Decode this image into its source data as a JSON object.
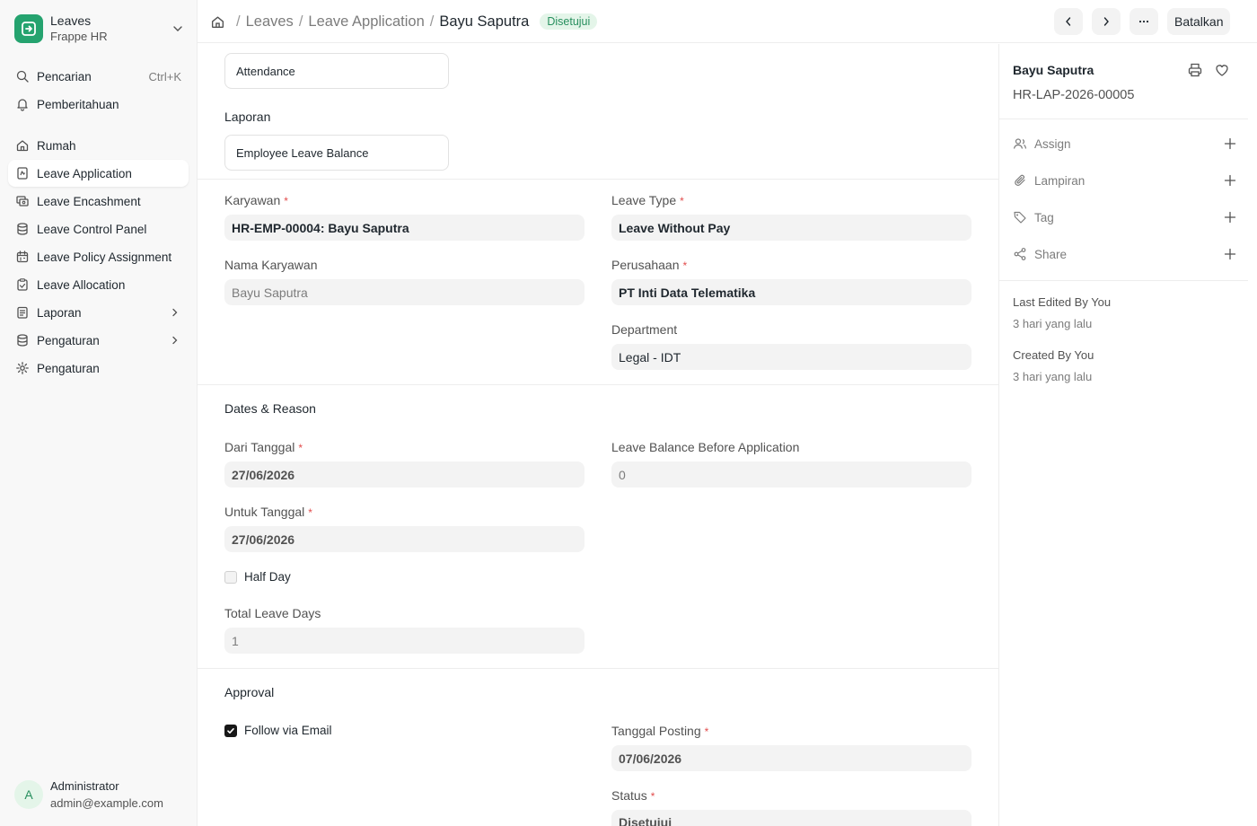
{
  "colors": {
    "brand": "#25a36f",
    "status_green_bg": "#e4f5e9",
    "status_green_text": "#278f5e",
    "required": "#e24c4c"
  },
  "app": {
    "name": "Leaves",
    "subtitle": "Frappe HR"
  },
  "sidebar": {
    "search": {
      "label": "Pencarian",
      "shortcut": "Ctrl+K",
      "icon": "search-icon"
    },
    "notifications": {
      "label": "Pemberitahuan",
      "icon": "bell-icon"
    },
    "items": [
      {
        "label": "Rumah",
        "icon": "home-icon"
      },
      {
        "label": "Leave Application",
        "icon": "leave-application-icon",
        "active": true
      },
      {
        "label": "Leave Encashment",
        "icon": "cash-icon"
      },
      {
        "label": "Leave Control Panel",
        "icon": "database-icon"
      },
      {
        "label": "Leave Policy Assignment",
        "icon": "calendar-icon"
      },
      {
        "label": "Leave Allocation",
        "icon": "clipboard-icon"
      },
      {
        "label": "Laporan",
        "icon": "report-icon",
        "expandable": true
      },
      {
        "label": "Pengaturan",
        "icon": "database-icon",
        "expandable": true
      },
      {
        "label": "Pengaturan",
        "icon": "gear-icon"
      }
    ],
    "user": {
      "initial": "A",
      "name": "Administrator",
      "email": "admin@example.com"
    }
  },
  "topbar": {
    "breadcrumb": [
      "Leaves",
      "Leave Application",
      "Bayu Saputra"
    ],
    "status": "Disetujui",
    "cancel_label": "Batalkan"
  },
  "form": {
    "links": {
      "attendance": "Attendance",
      "report_heading": "Laporan",
      "report_link": "Employee Leave Balance"
    },
    "employee": {
      "label": "Karyawan",
      "value": "HR-EMP-00004: Bayu Saputra"
    },
    "employee_name": {
      "label": "Nama Karyawan",
      "value": "Bayu Saputra"
    },
    "leave_type": {
      "label": "Leave Type",
      "value": "Leave Without Pay"
    },
    "company": {
      "label": "Perusahaan",
      "value": "PT Inti Data Telematika"
    },
    "department": {
      "label": "Department",
      "value": "Legal - IDT"
    },
    "dates_section": "Dates & Reason",
    "from_date": {
      "label": "Dari Tanggal",
      "value": "27/06/2026"
    },
    "to_date": {
      "label": "Untuk Tanggal",
      "value": "27/06/2026"
    },
    "half_day": {
      "label": "Half Day",
      "checked": false
    },
    "total_days": {
      "label": "Total Leave Days",
      "value": "1"
    },
    "balance": {
      "label": "Leave Balance Before Application",
      "value": "0"
    },
    "approval_section": "Approval",
    "follow_email": {
      "label": "Follow via Email",
      "checked": true
    },
    "posting_date": {
      "label": "Tanggal Posting",
      "value": "07/06/2026"
    },
    "status": {
      "label": "Status",
      "value": "Disetujui"
    }
  },
  "right_panel": {
    "title": "Bayu Saputra",
    "doc_id": "HR-LAP-2026-00005",
    "actions": [
      {
        "label": "Assign",
        "icon": "assign-icon"
      },
      {
        "label": "Lampiran",
        "icon": "paperclip-icon"
      },
      {
        "label": "Tag",
        "icon": "tag-icon"
      },
      {
        "label": "Share",
        "icon": "share-icon"
      }
    ],
    "last_edited": {
      "label": "Last Edited By You",
      "when": "3 hari yang lalu"
    },
    "created": {
      "label": "Created By You",
      "when": "3 hari yang lalu"
    }
  }
}
